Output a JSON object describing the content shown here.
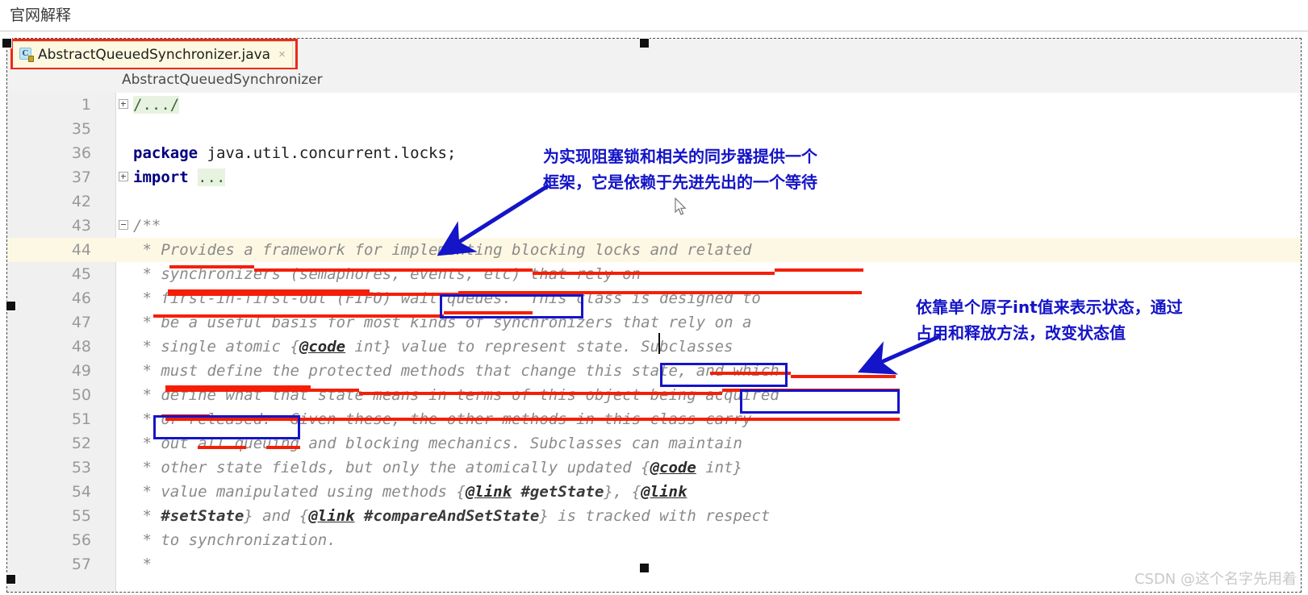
{
  "document": {
    "heading": "官网解释"
  },
  "ide": {
    "tab": {
      "label": "AbstractQueuedSynchronizer.java",
      "close_glyph": "×",
      "icon_letter": "C",
      "icon_name": "java-class-icon"
    },
    "breadcrumb": "AbstractQueuedSynchronizer",
    "lines": [
      {
        "num": "1",
        "fold": "plus",
        "kind": "fold",
        "text": "/.../"
      },
      {
        "num": "35",
        "fold": "",
        "kind": "blank",
        "text": ""
      },
      {
        "num": "36",
        "fold": "",
        "kind": "code",
        "keyword": "package",
        "text": " java.util.concurrent.locks;"
      },
      {
        "num": "37",
        "fold": "plus",
        "kind": "code",
        "keyword": "import",
        "text": " ..."
      },
      {
        "num": "42",
        "fold": "",
        "kind": "blank",
        "text": ""
      },
      {
        "num": "43",
        "fold": "minus",
        "kind": "cmt",
        "text": "/**"
      },
      {
        "num": "44",
        "fold": "",
        "kind": "cmt",
        "text": " * Provides a framework for implementing blocking locks and related",
        "highlight": true
      },
      {
        "num": "45",
        "fold": "",
        "kind": "cmt",
        "text": " * synchronizers (semaphores, events, etc) that rely on"
      },
      {
        "num": "46",
        "fold": "",
        "kind": "cmt",
        "text": " * first-in-first-out (FIFO) wait queues.  This class is designed to"
      },
      {
        "num": "47",
        "fold": "",
        "kind": "cmt",
        "text": " * be a useful basis for most kinds of synchronizers that rely on a"
      },
      {
        "num": "48",
        "fold": "",
        "kind": "cmt",
        "text": " * single atomic {@code int} value to represent state. Subclasses"
      },
      {
        "num": "49",
        "fold": "",
        "kind": "cmt",
        "text": " * must define the protected methods that change this state, and which"
      },
      {
        "num": "50",
        "fold": "",
        "kind": "cmt",
        "text": " * define what that state means in terms of this object being acquired"
      },
      {
        "num": "51",
        "fold": "",
        "kind": "cmt",
        "text": " * or released.  Given these, the other methods in this class carry"
      },
      {
        "num": "52",
        "fold": "",
        "kind": "cmt",
        "text": " * out all queuing and blocking mechanics. Subclasses can maintain"
      },
      {
        "num": "53",
        "fold": "",
        "kind": "cmt",
        "text": " * other state fields, but only the atomically updated {@code int}"
      },
      {
        "num": "54",
        "fold": "",
        "kind": "cmt",
        "text": " * value manipulated using methods {@link #getState}, {@link"
      },
      {
        "num": "55",
        "fold": "",
        "kind": "cmt",
        "text": " * #setState} and {@link #compareAndSetState} is tracked with respect"
      },
      {
        "num": "56",
        "fold": "",
        "kind": "cmt",
        "text": " * to synchronization."
      },
      {
        "num": "57",
        "fold": "",
        "kind": "cmt",
        "text": " *"
      }
    ]
  },
  "annotations": {
    "note_top": {
      "line1": "为实现阻塞锁和相关的同步器提供一个",
      "line2": "框架，它是依赖于先进先出的一个等待"
    },
    "note_right": {
      "line1": "依靠单个原子int值来表示状态，通过",
      "line2": "占用和释放方法，改变状态值"
    },
    "colors": {
      "underline_red": "#f51f07",
      "box_blue": "#1414c8",
      "highlight_red": "#ee2a16",
      "note_blue": "#1414c8"
    }
  },
  "watermark": "CSDN @这个名字先用着"
}
